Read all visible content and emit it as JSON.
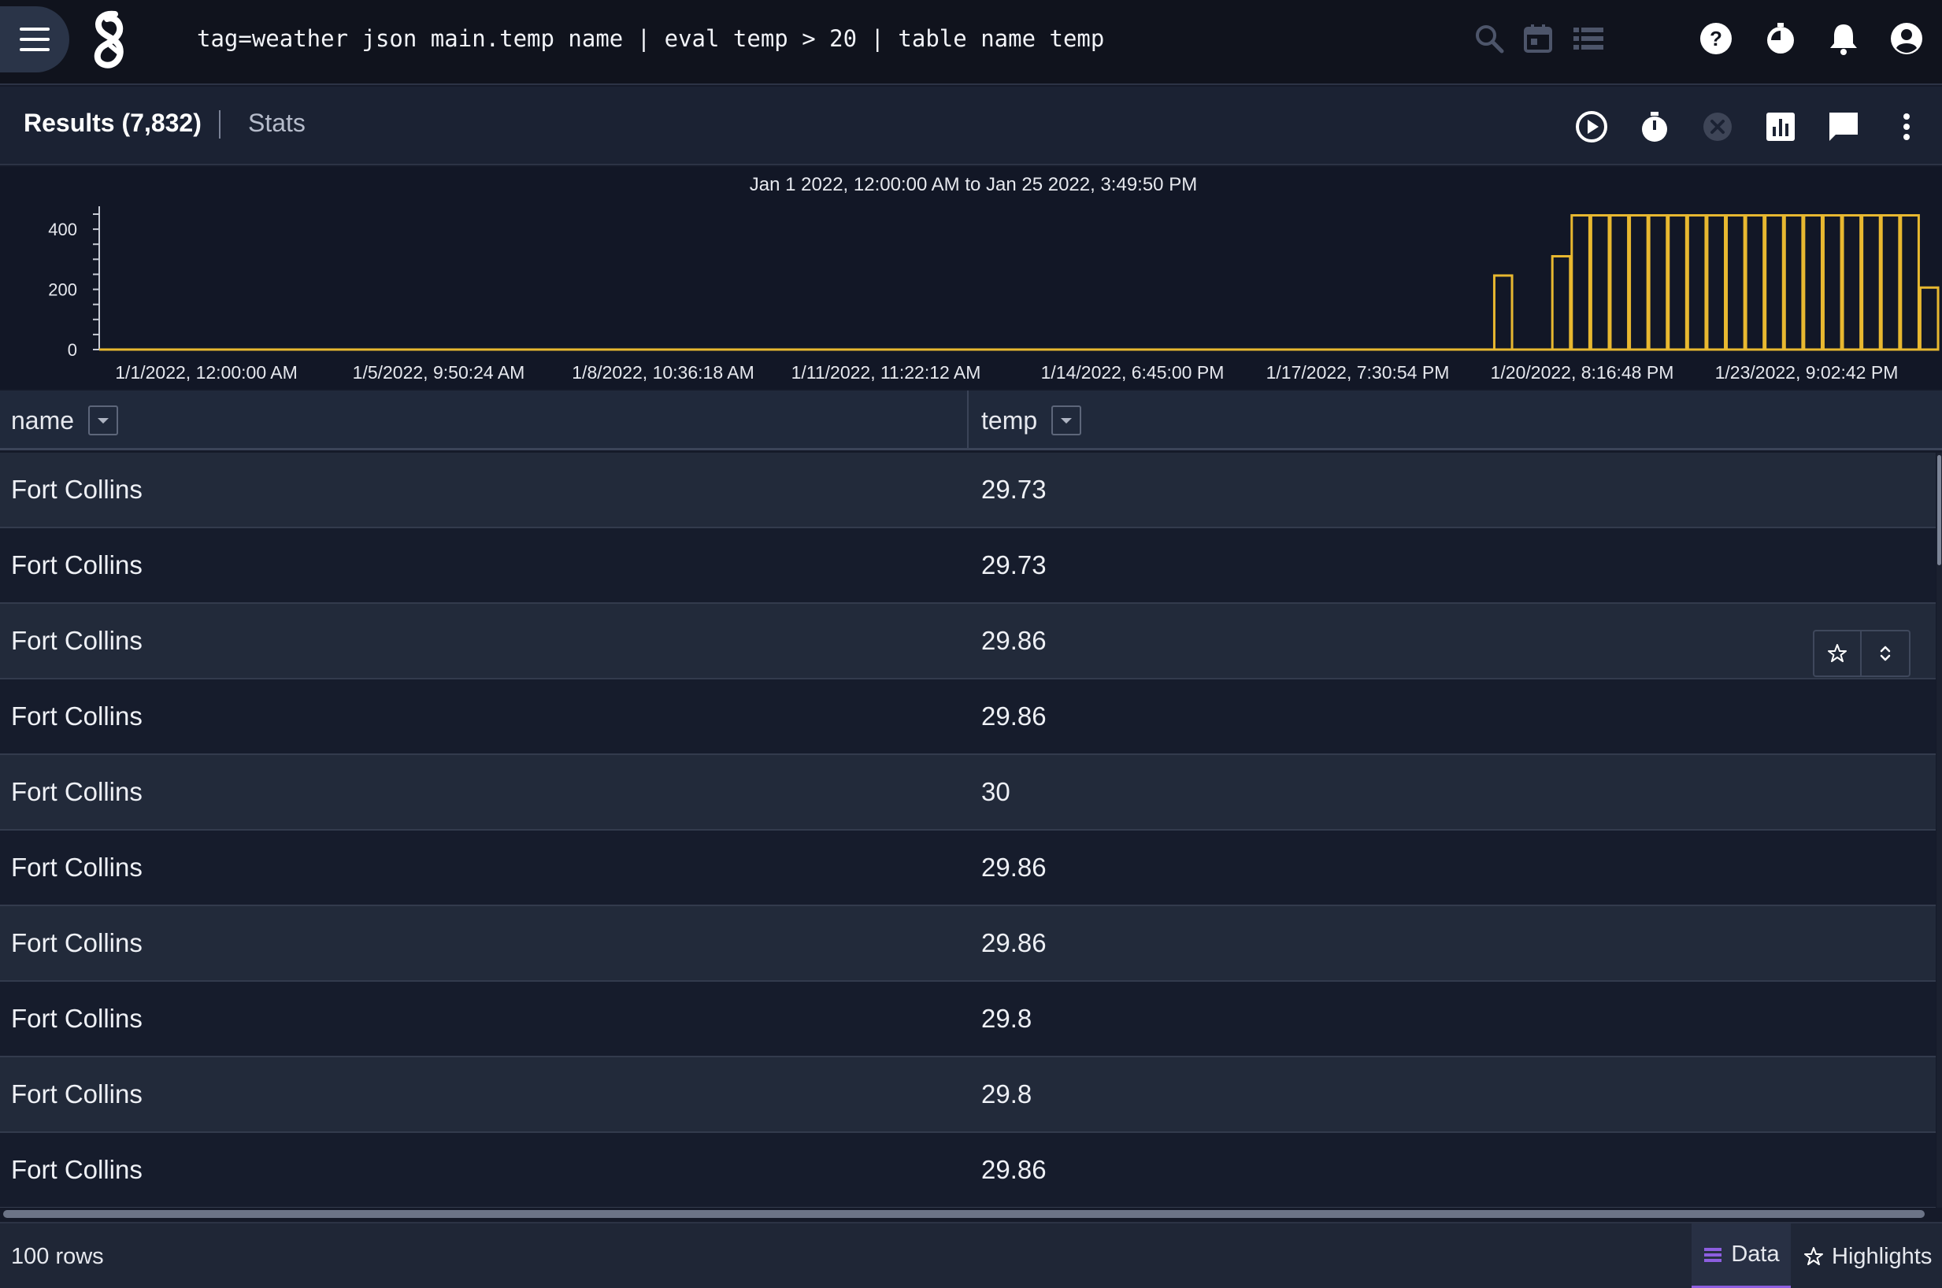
{
  "topbar": {
    "query": "tag=weather json main.temp name | eval temp > 20 | table name temp",
    "icons": [
      "menu-icon",
      "gravwell-logo",
      "search-icon",
      "calendar-icon",
      "list-icon",
      "help-icon",
      "timer-icon",
      "bell-icon",
      "account-icon"
    ]
  },
  "results_bar": {
    "results_label": "Results (7,832)",
    "separator": "|",
    "stats_label": "Stats",
    "icons": [
      "play-icon",
      "stopwatch-icon",
      "cancel-icon",
      "chart-icon",
      "comment-icon",
      "more-vert-icon"
    ]
  },
  "chart_data": {
    "type": "bar",
    "title": "Jan 1 2022, 12:00:00 AM to Jan 25 2022, 3:49:50 PM",
    "xlabel": "",
    "ylabel": "",
    "ylim": [
      0,
      450
    ],
    "yticks": [
      "400",
      "200",
      "0"
    ],
    "ytick_values": [
      400,
      200,
      0
    ],
    "xticks": [
      "1/1/2022, 12:00:00 AM",
      "1/5/2022, 9:50:24 AM",
      "1/8/2022, 10:36:18 AM",
      "1/11/2022, 11:22:12 AM",
      "1/14/2022, 6:45:00 PM",
      "1/17/2022, 7:30:54 PM",
      "1/20/2022, 8:16:48 PM",
      "1/23/2022, 9:02:42 PM"
    ],
    "bins": 90,
    "values": [
      0,
      0,
      0,
      0,
      0,
      0,
      0,
      0,
      0,
      0,
      0,
      0,
      0,
      0,
      0,
      0,
      0,
      0,
      0,
      0,
      0,
      0,
      0,
      0,
      0,
      0,
      0,
      0,
      0,
      0,
      0,
      0,
      0,
      0,
      0,
      0,
      0,
      0,
      0,
      0,
      0,
      0,
      0,
      0,
      0,
      0,
      0,
      0,
      0,
      0,
      0,
      0,
      0,
      0,
      0,
      0,
      0,
      0,
      0,
      0,
      0,
      0,
      0,
      0,
      0,
      0,
      0,
      0,
      0,
      0,
      0,
      0,
      246,
      0,
      0,
      310,
      446,
      446,
      446,
      446,
      446,
      446,
      446,
      446,
      446,
      446,
      446,
      446,
      446,
      446,
      446,
      446,
      446,
      446,
      206
    ],
    "color": "#e8b830",
    "grid": false,
    "legend": "none"
  },
  "table": {
    "columns": [
      "name",
      "temp"
    ],
    "rows": [
      [
        "Fort Collins",
        "29.73"
      ],
      [
        "Fort Collins",
        "29.73"
      ],
      [
        "Fort Collins",
        "29.86"
      ],
      [
        "Fort Collins",
        "29.86"
      ],
      [
        "Fort Collins",
        "30"
      ],
      [
        "Fort Collins",
        "29.86"
      ],
      [
        "Fort Collins",
        "29.86"
      ],
      [
        "Fort Collins",
        "29.8"
      ],
      [
        "Fort Collins",
        "29.8"
      ],
      [
        "Fort Collins",
        "29.86"
      ]
    ]
  },
  "footer": {
    "row_count": "100 rows",
    "data_tab": "Data",
    "highlights_tab": "Highlights",
    "accent": "#8d5ee0"
  }
}
